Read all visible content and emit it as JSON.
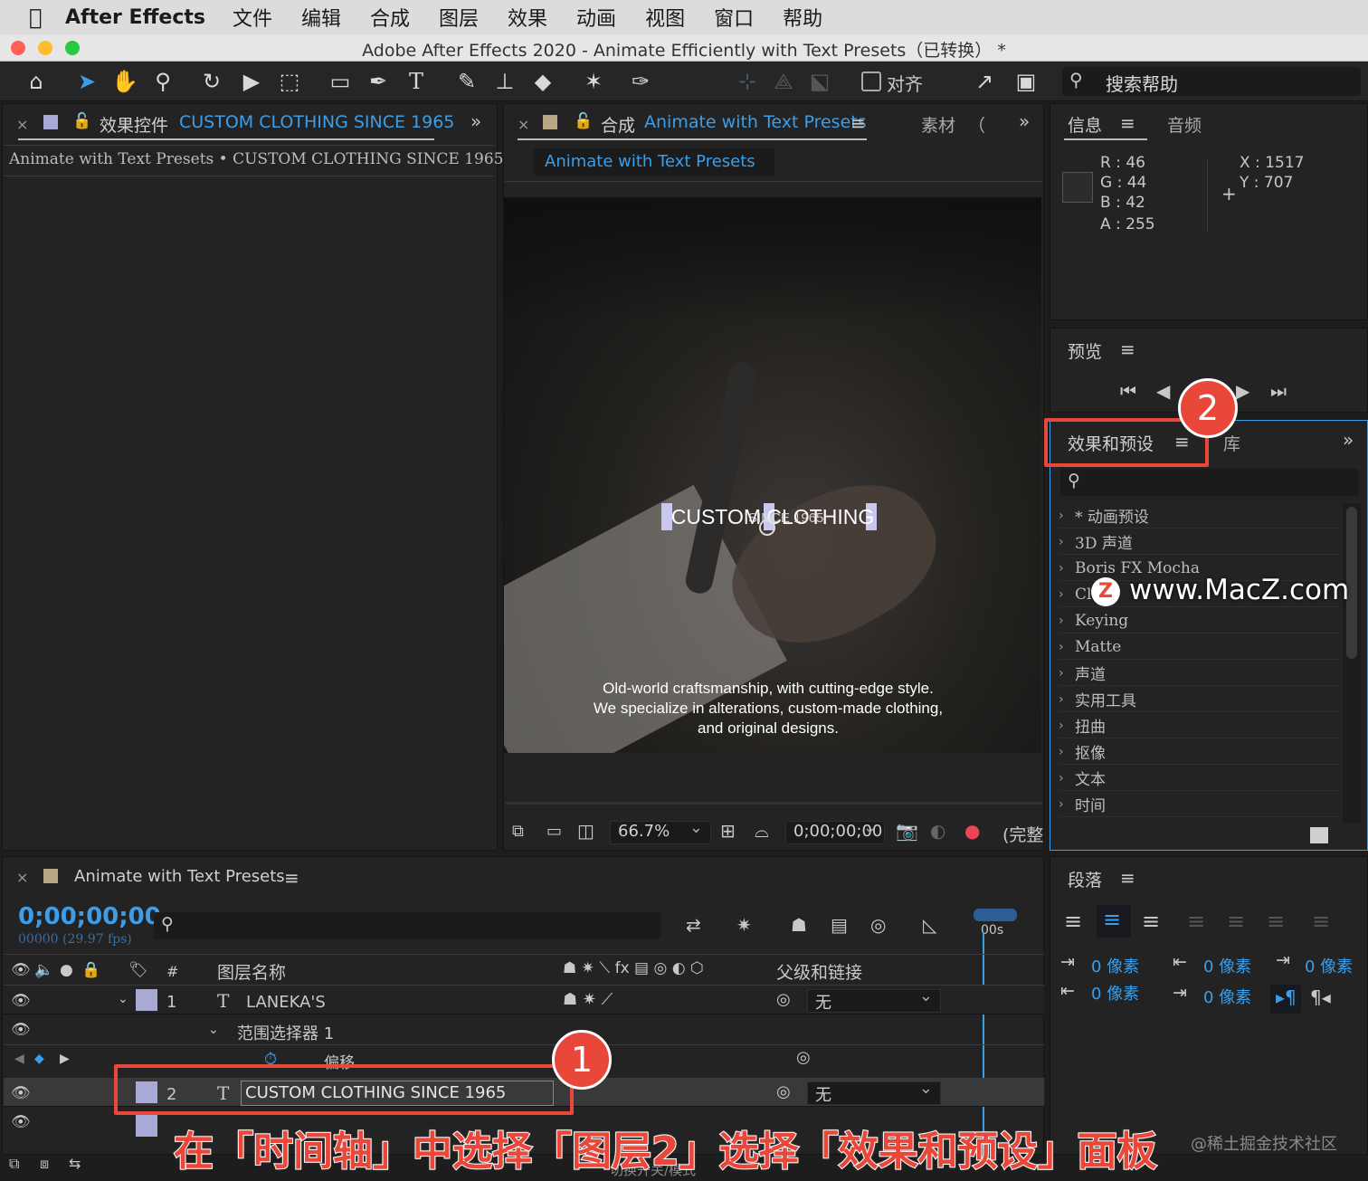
{
  "menubar": {
    "app": "After Effects",
    "items": [
      "文件",
      "编辑",
      "合成",
      "图层",
      "效果",
      "动画",
      "视图",
      "窗口",
      "帮助"
    ]
  },
  "window": {
    "title": "Adobe After Effects 2020 - Animate Efficiently with Text Presets（已转换） *"
  },
  "toolbar": {
    "snap_label": "对齐",
    "search_placeholder": "搜索帮助"
  },
  "effect_controls": {
    "tab_prefix": "效果控件",
    "tab_layer": "CUSTOM CLOTHING  SINCE 1965",
    "breadcrumb": "Animate with Text Presets • CUSTOM CLOTHING  SINCE 1965"
  },
  "comp_panel": {
    "tab_prefix": "合成",
    "tab_name": "Animate with Text Presets",
    "tab_footage": "素材",
    "footage_paren": "（",
    "subtab": "Animate with Text Presets",
    "viewer": {
      "title_text": "CUSTOM CLOTHING",
      "overlap_text": "SINCE 1965",
      "body_lines": [
        "Old-world craftsmanship, with cutting-edge style.",
        "We specialize in alterations, custom-made clothing,",
        "and original designs."
      ]
    },
    "bottom": {
      "zoom": "66.7%",
      "timecode": "0;00;00;00",
      "quality": "(完整"
    }
  },
  "info": {
    "tab": "信息",
    "tab2": "音频",
    "r": "R :  46",
    "g": "G :  44",
    "b": "B :  42",
    "a": "A :  255",
    "x": "X : 1517",
    "y": "Y :  707"
  },
  "preview": {
    "tab": "预览"
  },
  "effects": {
    "tab": "效果和预设",
    "tab2": "库",
    "items": [
      "* 动画预设",
      "3D 声道",
      "Boris FX Mocha",
      "Cl…",
      "Keying",
      "Matte",
      "声道",
      "实用工具",
      "扭曲",
      "抠像",
      "文本",
      "时间"
    ]
  },
  "watermark": {
    "logo": "Z",
    "site": "www.MacZ.com"
  },
  "timeline": {
    "tab": "Animate with Text Presets",
    "timecode": "0;00;00;00",
    "fps": "00000 (29.97 fps)",
    "col_num": "#",
    "col_name": "图层名称",
    "col_parent": "父级和链接",
    "ruler": "00s",
    "layers": [
      {
        "num": "1",
        "type": "T",
        "name": "LANEKA'S",
        "parent": "无"
      },
      {
        "num": "2",
        "type": "T",
        "name": "CUSTOM CLOTHING  SINCE 1965",
        "parent": "无"
      }
    ],
    "selector": "范围选择器 1",
    "offset": "偏移",
    "hint": "切换开关/模式"
  },
  "paragraph": {
    "tab": "段落",
    "v1": "0 像素",
    "v2": "0 像素",
    "v3": "0 像素",
    "v4": "0 像素",
    "v5": "0 像素"
  },
  "annotation": {
    "badge1": "1",
    "badge2": "2",
    "caption": "在「时间轴」中选择「图层2」选择「效果和预设」面板",
    "credit": "@稀土掘金技术社区"
  },
  "colors": {
    "accent": "#3c9ee8",
    "red": "#e8473a",
    "label_lavender": "#a9a9d6"
  }
}
